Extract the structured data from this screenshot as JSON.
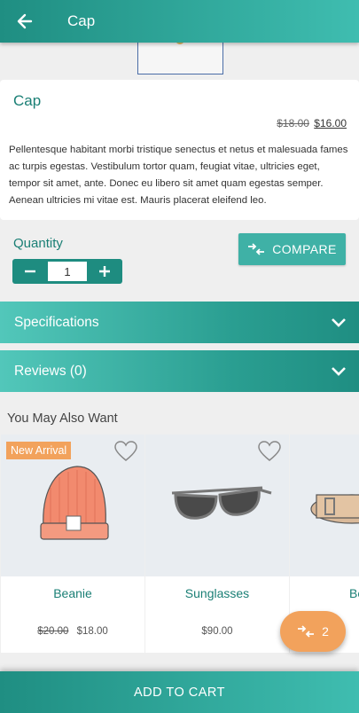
{
  "app_bar": {
    "title": "Cap",
    "back_icon": "arrow-left-icon"
  },
  "product": {
    "name": "Cap",
    "old_price": "$18.00",
    "new_price": "$16.00",
    "description": "Pellentesque habitant morbi tristique senectus et netus et malesuada fames ac turpis egestas. Vestibulum tortor quam, feugiat vitae, ultricies eget, tempor sit amet, ante. Donec eu libero sit amet quam egestas semper. Aenean ultricies mi vitae est. Mauris placerat eleifend leo."
  },
  "quantity": {
    "label": "Quantity",
    "value": "1",
    "minus": "−",
    "plus": "+"
  },
  "compare_button": {
    "label": "COMPARE",
    "icon": "compare-arrows-icon"
  },
  "accordions": [
    {
      "label": "Specifications",
      "icon": "chevron-down-icon"
    },
    {
      "label": "Reviews (0)",
      "icon": "chevron-down-icon"
    }
  ],
  "related": {
    "title": "You May Also Want",
    "items": [
      {
        "name": "Beanie",
        "old_price": "$20.00",
        "price": "$18.00",
        "badge": "New Arrival",
        "image": "beanie-image"
      },
      {
        "name": "Sunglasses",
        "old_price": "",
        "price": "$90.00",
        "badge": "",
        "image": "sunglasses-image"
      },
      {
        "name": "Be",
        "old_price": "",
        "price": "",
        "badge": "",
        "image": "belt-image"
      }
    ]
  },
  "fab": {
    "count": "2",
    "icon": "compare-arrows-icon"
  },
  "add_to_cart": {
    "label": "ADD TO CART"
  },
  "colors": {
    "primary": "#1f8e82",
    "accent": "#3fbdb0",
    "orange": "#f2a25c"
  }
}
